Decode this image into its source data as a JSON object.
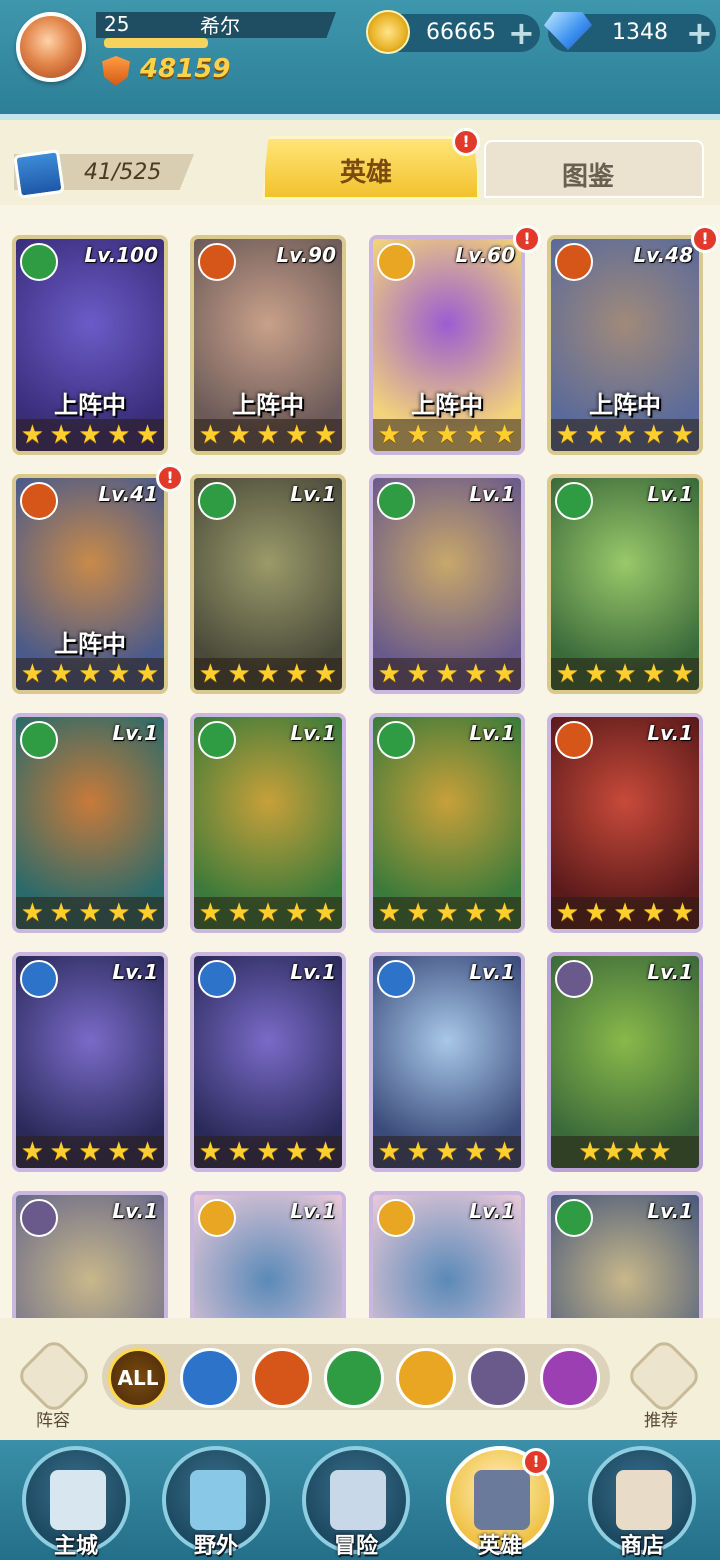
{
  "player": {
    "level": "25",
    "name": "希尔",
    "xp_fraction": 0.45,
    "power": "48159"
  },
  "resources": {
    "gold": "66665",
    "gems": "1348",
    "add_label": "+"
  },
  "collection": {
    "count": "41/525"
  },
  "tabs": [
    {
      "label": "英雄",
      "active": true,
      "alert": "!"
    },
    {
      "label": "图鉴",
      "active": false
    }
  ],
  "colors": {
    "nature": "#2f9c43",
    "fire": "#d6561a",
    "light": "#e8a623",
    "water": "#2c73c9",
    "dark": "#6a5a8c",
    "arcane": "#9b3fb3"
  },
  "heroes": [
    {
      "level": "Lv.100",
      "element": "nature",
      "status": "上阵中",
      "stars": 5,
      "alert": ""
    },
    {
      "level": "Lv.90",
      "element": "fire",
      "status": "上阵中",
      "stars": 5,
      "alert": ""
    },
    {
      "level": "Lv.60",
      "element": "light",
      "status": "上阵中",
      "stars": 5,
      "alert": "!"
    },
    {
      "level": "Lv.48",
      "element": "fire",
      "status": "上阵中",
      "stars": 5,
      "alert": "!"
    },
    {
      "level": "Lv.41",
      "element": "fire",
      "status": "上阵中",
      "stars": 5,
      "alert": "!"
    },
    {
      "level": "Lv.1",
      "element": "nature",
      "status": "",
      "stars": 5,
      "alert": ""
    },
    {
      "level": "Lv.1",
      "element": "nature",
      "status": "",
      "stars": 5,
      "alert": ""
    },
    {
      "level": "Lv.1",
      "element": "nature",
      "status": "",
      "stars": 5,
      "alert": ""
    },
    {
      "level": "Lv.1",
      "element": "nature",
      "status": "",
      "stars": 5,
      "alert": ""
    },
    {
      "level": "Lv.1",
      "element": "nature",
      "status": "",
      "stars": 5,
      "alert": ""
    },
    {
      "level": "Lv.1",
      "element": "nature",
      "status": "",
      "stars": 5,
      "alert": ""
    },
    {
      "level": "Lv.1",
      "element": "fire",
      "status": "",
      "stars": 5,
      "alert": ""
    },
    {
      "level": "Lv.1",
      "element": "water",
      "status": "",
      "stars": 5,
      "alert": ""
    },
    {
      "level": "Lv.1",
      "element": "water",
      "status": "",
      "stars": 5,
      "alert": ""
    },
    {
      "level": "Lv.1",
      "element": "water",
      "status": "",
      "stars": 5,
      "alert": ""
    },
    {
      "level": "Lv.1",
      "element": "dark",
      "status": "",
      "stars": 4,
      "alert": ""
    },
    {
      "level": "Lv.1",
      "element": "dark",
      "status": "",
      "stars": 0,
      "alert": ""
    },
    {
      "level": "Lv.1",
      "element": "light",
      "status": "",
      "stars": 0,
      "alert": ""
    },
    {
      "level": "Lv.1",
      "element": "light",
      "status": "",
      "stars": 0,
      "alert": ""
    },
    {
      "level": "Lv.1",
      "element": "nature",
      "status": "",
      "stars": 0,
      "alert": ""
    }
  ],
  "filters": {
    "left_label": "阵容",
    "right_label": "推荐",
    "buttons": [
      {
        "label": "ALL",
        "icon": "all-icon"
      },
      {
        "label": "",
        "icon": "water-element-icon"
      },
      {
        "label": "",
        "icon": "fire-element-icon"
      },
      {
        "label": "",
        "icon": "nature-element-icon"
      },
      {
        "label": "",
        "icon": "light-element-icon"
      },
      {
        "label": "",
        "icon": "dark-element-icon"
      },
      {
        "label": "",
        "icon": "arcane-element-icon"
      }
    ]
  },
  "nav": [
    {
      "label": "主城",
      "icon": "castle-icon",
      "active": false,
      "alert": ""
    },
    {
      "label": "野外",
      "icon": "portal-icon",
      "active": false,
      "alert": ""
    },
    {
      "label": "冒险",
      "icon": "sword-icon",
      "active": false,
      "alert": ""
    },
    {
      "label": "英雄",
      "icon": "helmet-icon",
      "active": true,
      "alert": "!"
    },
    {
      "label": "商店",
      "icon": "shop-icon",
      "active": false,
      "alert": ""
    }
  ]
}
